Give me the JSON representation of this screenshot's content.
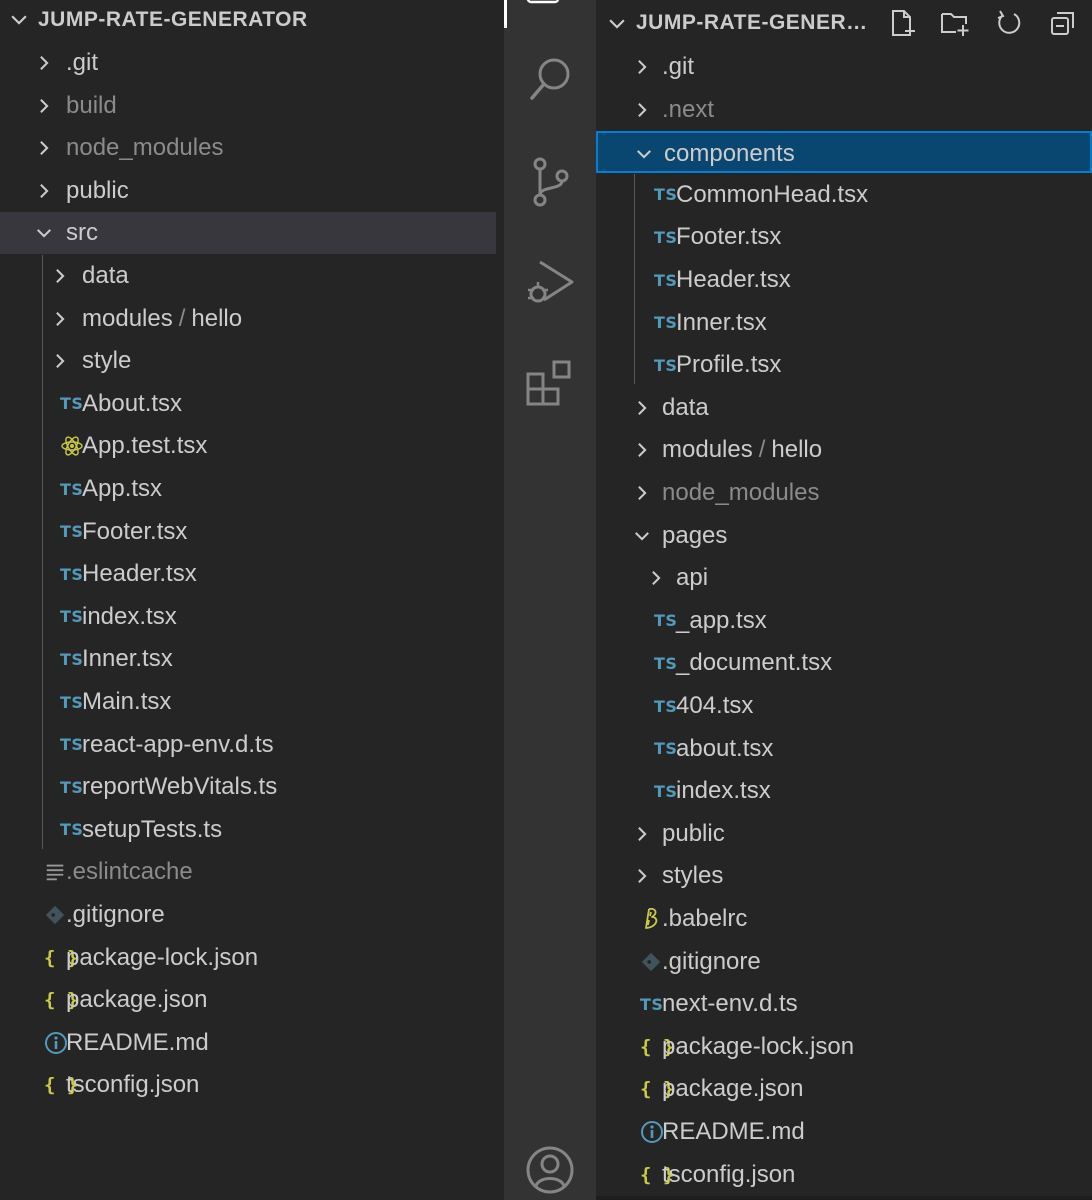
{
  "left_explorer": {
    "title": "JUMP-RATE-GENERATOR",
    "items": [
      {
        "label": ".git",
        "kind": "folder",
        "state": "collapsed",
        "depth": 0,
        "dim": false
      },
      {
        "label": "build",
        "kind": "folder",
        "state": "collapsed",
        "depth": 0,
        "dim": true
      },
      {
        "label": "node_modules",
        "kind": "folder",
        "state": "collapsed",
        "depth": 0,
        "dim": true
      },
      {
        "label": "public",
        "kind": "folder",
        "state": "collapsed",
        "depth": 0,
        "dim": false
      },
      {
        "label": "src",
        "kind": "folder",
        "state": "expanded",
        "depth": 0,
        "dim": false,
        "active": true
      },
      {
        "label": "data",
        "kind": "folder",
        "state": "collapsed",
        "depth": 1,
        "dim": false
      },
      {
        "label": "modules",
        "label2": "hello",
        "kind": "folder",
        "state": "collapsed",
        "depth": 1,
        "dim": false
      },
      {
        "label": "style",
        "kind": "folder",
        "state": "collapsed",
        "depth": 1,
        "dim": false
      },
      {
        "label": "About.tsx",
        "kind": "ts",
        "depth": 1
      },
      {
        "label": "App.test.tsx",
        "kind": "react",
        "depth": 1
      },
      {
        "label": "App.tsx",
        "kind": "ts",
        "depth": 1
      },
      {
        "label": "Footer.tsx",
        "kind": "ts",
        "depth": 1
      },
      {
        "label": "Header.tsx",
        "kind": "ts",
        "depth": 1
      },
      {
        "label": "index.tsx",
        "kind": "ts",
        "depth": 1
      },
      {
        "label": "Inner.tsx",
        "kind": "ts",
        "depth": 1
      },
      {
        "label": "Main.tsx",
        "kind": "ts",
        "depth": 1
      },
      {
        "label": "react-app-env.d.ts",
        "kind": "ts",
        "depth": 1
      },
      {
        "label": "reportWebVitals.ts",
        "kind": "ts",
        "depth": 1
      },
      {
        "label": "setupTests.ts",
        "kind": "ts",
        "depth": 1
      },
      {
        "label": ".eslintcache",
        "kind": "lines",
        "depth": 0,
        "dim": true
      },
      {
        "label": ".gitignore",
        "kind": "git",
        "depth": 0
      },
      {
        "label": "package-lock.json",
        "kind": "json",
        "depth": 0
      },
      {
        "label": "package.json",
        "kind": "json",
        "depth": 0
      },
      {
        "label": "README.md",
        "kind": "info",
        "depth": 0
      },
      {
        "label": "tsconfig.json",
        "kind": "json",
        "depth": 0
      }
    ]
  },
  "activity_bar": {
    "icons": [
      "files-icon",
      "search-icon",
      "source-control-icon",
      "run-debug-icon",
      "extensions-icon",
      "account-icon"
    ]
  },
  "right_explorer": {
    "title": "JUMP-RATE-GENERATOR",
    "actions": [
      "new-file-icon",
      "new-folder-icon",
      "refresh-icon",
      "collapse-all-icon"
    ],
    "items": [
      {
        "label": ".git",
        "kind": "folder",
        "state": "collapsed",
        "depth": 0,
        "dim": false
      },
      {
        "label": ".next",
        "kind": "folder",
        "state": "collapsed",
        "depth": 0,
        "dim": true
      },
      {
        "label": "components",
        "kind": "folder",
        "state": "expanded",
        "depth": 0,
        "dim": false,
        "selected": true
      },
      {
        "label": "CommonHead.tsx",
        "kind": "ts",
        "depth": 1
      },
      {
        "label": "Footer.tsx",
        "kind": "ts",
        "depth": 1
      },
      {
        "label": "Header.tsx",
        "kind": "ts",
        "depth": 1
      },
      {
        "label": "Inner.tsx",
        "kind": "ts",
        "depth": 1
      },
      {
        "label": "Profile.tsx",
        "kind": "ts",
        "depth": 1
      },
      {
        "label": "data",
        "kind": "folder",
        "state": "collapsed",
        "depth": 0,
        "dim": false
      },
      {
        "label": "modules",
        "label2": "hello",
        "kind": "folder",
        "state": "collapsed",
        "depth": 0,
        "dim": false
      },
      {
        "label": "node_modules",
        "kind": "folder",
        "state": "collapsed",
        "depth": 0,
        "dim": true
      },
      {
        "label": "pages",
        "kind": "folder",
        "state": "expanded",
        "depth": 0,
        "dim": false
      },
      {
        "label": "api",
        "kind": "folder",
        "state": "collapsed",
        "depth": 1,
        "dim": false
      },
      {
        "label": "_app.tsx",
        "kind": "ts",
        "depth": 1
      },
      {
        "label": "_document.tsx",
        "kind": "ts",
        "depth": 1
      },
      {
        "label": "404.tsx",
        "kind": "ts",
        "depth": 1
      },
      {
        "label": "about.tsx",
        "kind": "ts",
        "depth": 1
      },
      {
        "label": "index.tsx",
        "kind": "ts",
        "depth": 1
      },
      {
        "label": "public",
        "kind": "folder",
        "state": "collapsed",
        "depth": 0,
        "dim": false
      },
      {
        "label": "styles",
        "kind": "folder",
        "state": "collapsed",
        "depth": 0,
        "dim": false
      },
      {
        "label": ".babelrc",
        "kind": "babel",
        "depth": 0
      },
      {
        "label": ".gitignore",
        "kind": "git",
        "depth": 0
      },
      {
        "label": "next-env.d.ts",
        "kind": "ts",
        "depth": 0
      },
      {
        "label": "package-lock.json",
        "kind": "json",
        "depth": 0
      },
      {
        "label": "package.json",
        "kind": "json",
        "depth": 0
      },
      {
        "label": "README.md",
        "kind": "info",
        "depth": 0
      },
      {
        "label": "tsconfig.json",
        "kind": "json",
        "depth": 0
      }
    ]
  },
  "icon_glyphs": {
    "ts": "TS",
    "json": "{ }"
  },
  "colors": {
    "sidebar_bg": "#252526",
    "activity_bg": "#333333",
    "selected_bg": "#094771",
    "selected_border": "#007fd4",
    "ts_icon": "#519aba",
    "json_icon": "#cbcb41",
    "react_icon": "#cbcb41",
    "dim_text": "#8b8b8b"
  }
}
